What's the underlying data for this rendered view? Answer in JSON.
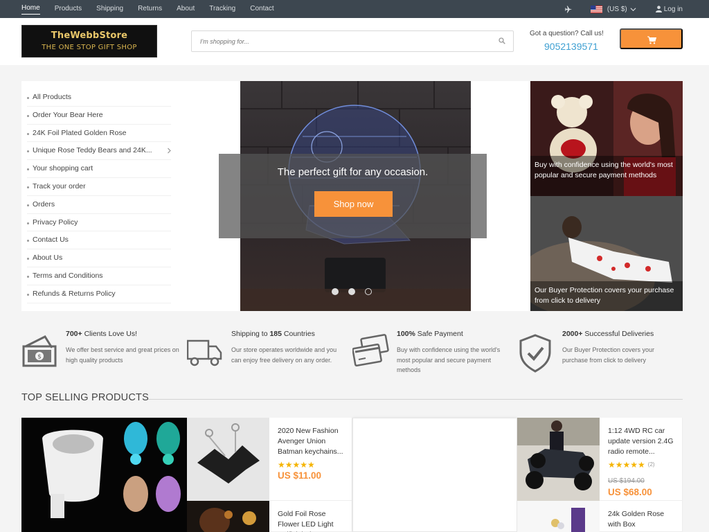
{
  "nav": {
    "links": [
      "Home",
      "Products",
      "Shipping",
      "Returns",
      "About",
      "Tracking",
      "Contact"
    ],
    "currency": "(US $)",
    "login": "Log in"
  },
  "header": {
    "logo_line1": "TheWebbStore",
    "logo_line2": "THE ONE STOP GIFT SHOP",
    "search_placeholder": "I'm shopping for...",
    "question": "Got a question? Call us!",
    "phone": "9052139571"
  },
  "categories": [
    "All Products",
    "Order Your Bear Here",
    "24K Foil Plated Golden Rose",
    "Unique Rose Teddy Bears and 24K...",
    "Your shopping cart",
    "Track your order",
    "Orders",
    "Privacy Policy",
    "Contact Us",
    "About Us",
    "Terms and Conditions",
    "Refunds & Returns Policy"
  ],
  "hero": {
    "tagline": "The perfect gift for any occasion.",
    "cta": "Shop now"
  },
  "banners": [
    {
      "caption": "Buy with confidence using the world's most popular and secure payment methods"
    },
    {
      "caption": "Our Buyer Protection covers your purchase from click to delivery"
    }
  ],
  "features": [
    {
      "bold": "700+",
      "title_rest": " Clients Love Us!",
      "desc": "We offer best service and great prices on high quality products"
    },
    {
      "title_pre": "Shipping to ",
      "bold": "185",
      "title_rest": " Countries",
      "desc": "Our store operates worldwide and you can enjoy free delivery on any order."
    },
    {
      "bold": "100%",
      "title_rest": " Safe Payment",
      "desc": "Buy with confidence using the world's most popular and secure payment methods"
    },
    {
      "bold": "2000+",
      "title_rest": " Successful Deliveries",
      "desc": "Our Buyer Protection covers your purchase from click to delivery"
    }
  ],
  "section_title": "TOP SELLING PRODUCTS",
  "products": [
    {
      "name": "2020 New Fashion Avenger Union Batman keychains...",
      "stars": "★★★★★",
      "price": "US $11.00"
    },
    {
      "name": "Gold Foil Rose Flower LED Light Artificial Flower..."
    },
    {
      "name": "1:12 4WD RC car update version 2.4G radio remote...",
      "stars": "★★★★★",
      "reviews": "(2)",
      "old_price": "US $194.00",
      "price": "US $68.00"
    },
    {
      "name": "24k Golden Rose with Box"
    }
  ],
  "colors": {
    "accent": "#f7923a",
    "topbar": "#3d4750",
    "phone": "#3fa0d2"
  }
}
